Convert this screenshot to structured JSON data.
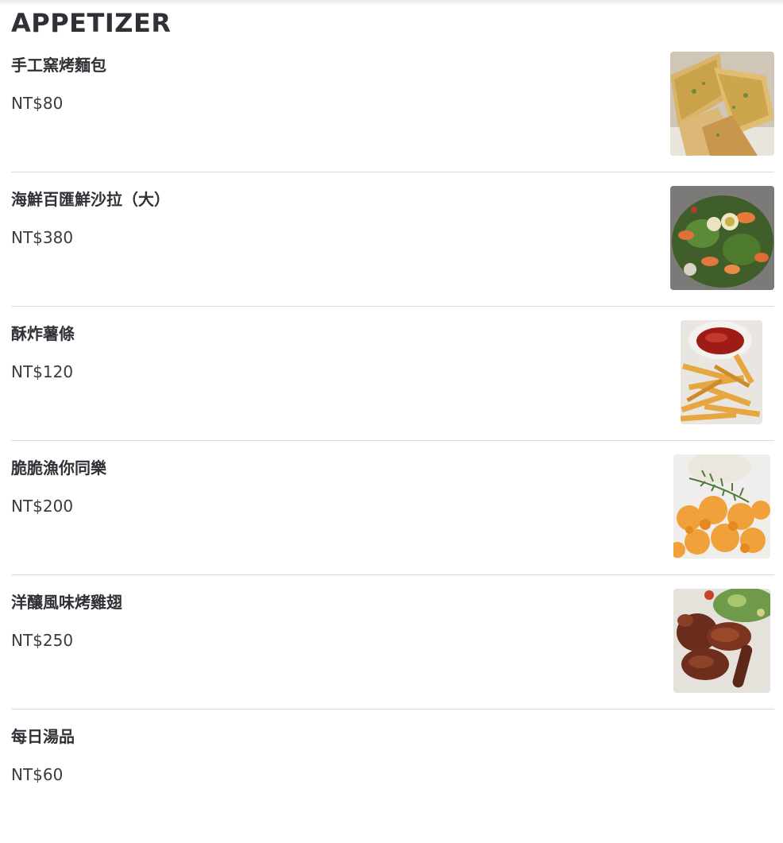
{
  "section": {
    "title": "APPETIZER"
  },
  "items": [
    {
      "name": "手工窯烤麵包",
      "price": "NT$80",
      "image": "garlic-flatbread-image"
    },
    {
      "name": "海鮮百匯鮮沙拉（大）",
      "price": "NT$380",
      "image": "seafood-salad-image"
    },
    {
      "name": "酥炸薯條",
      "price": "NT$120",
      "image": "french-fries-image"
    },
    {
      "name": "脆脆漁你同樂",
      "price": "NT$200",
      "image": "fried-seafood-image"
    },
    {
      "name": "洋釀風味烤雞翅",
      "price": "NT$250",
      "image": "roast-chicken-wings-image"
    },
    {
      "name": "每日湯品",
      "price": "NT$60"
    }
  ]
}
